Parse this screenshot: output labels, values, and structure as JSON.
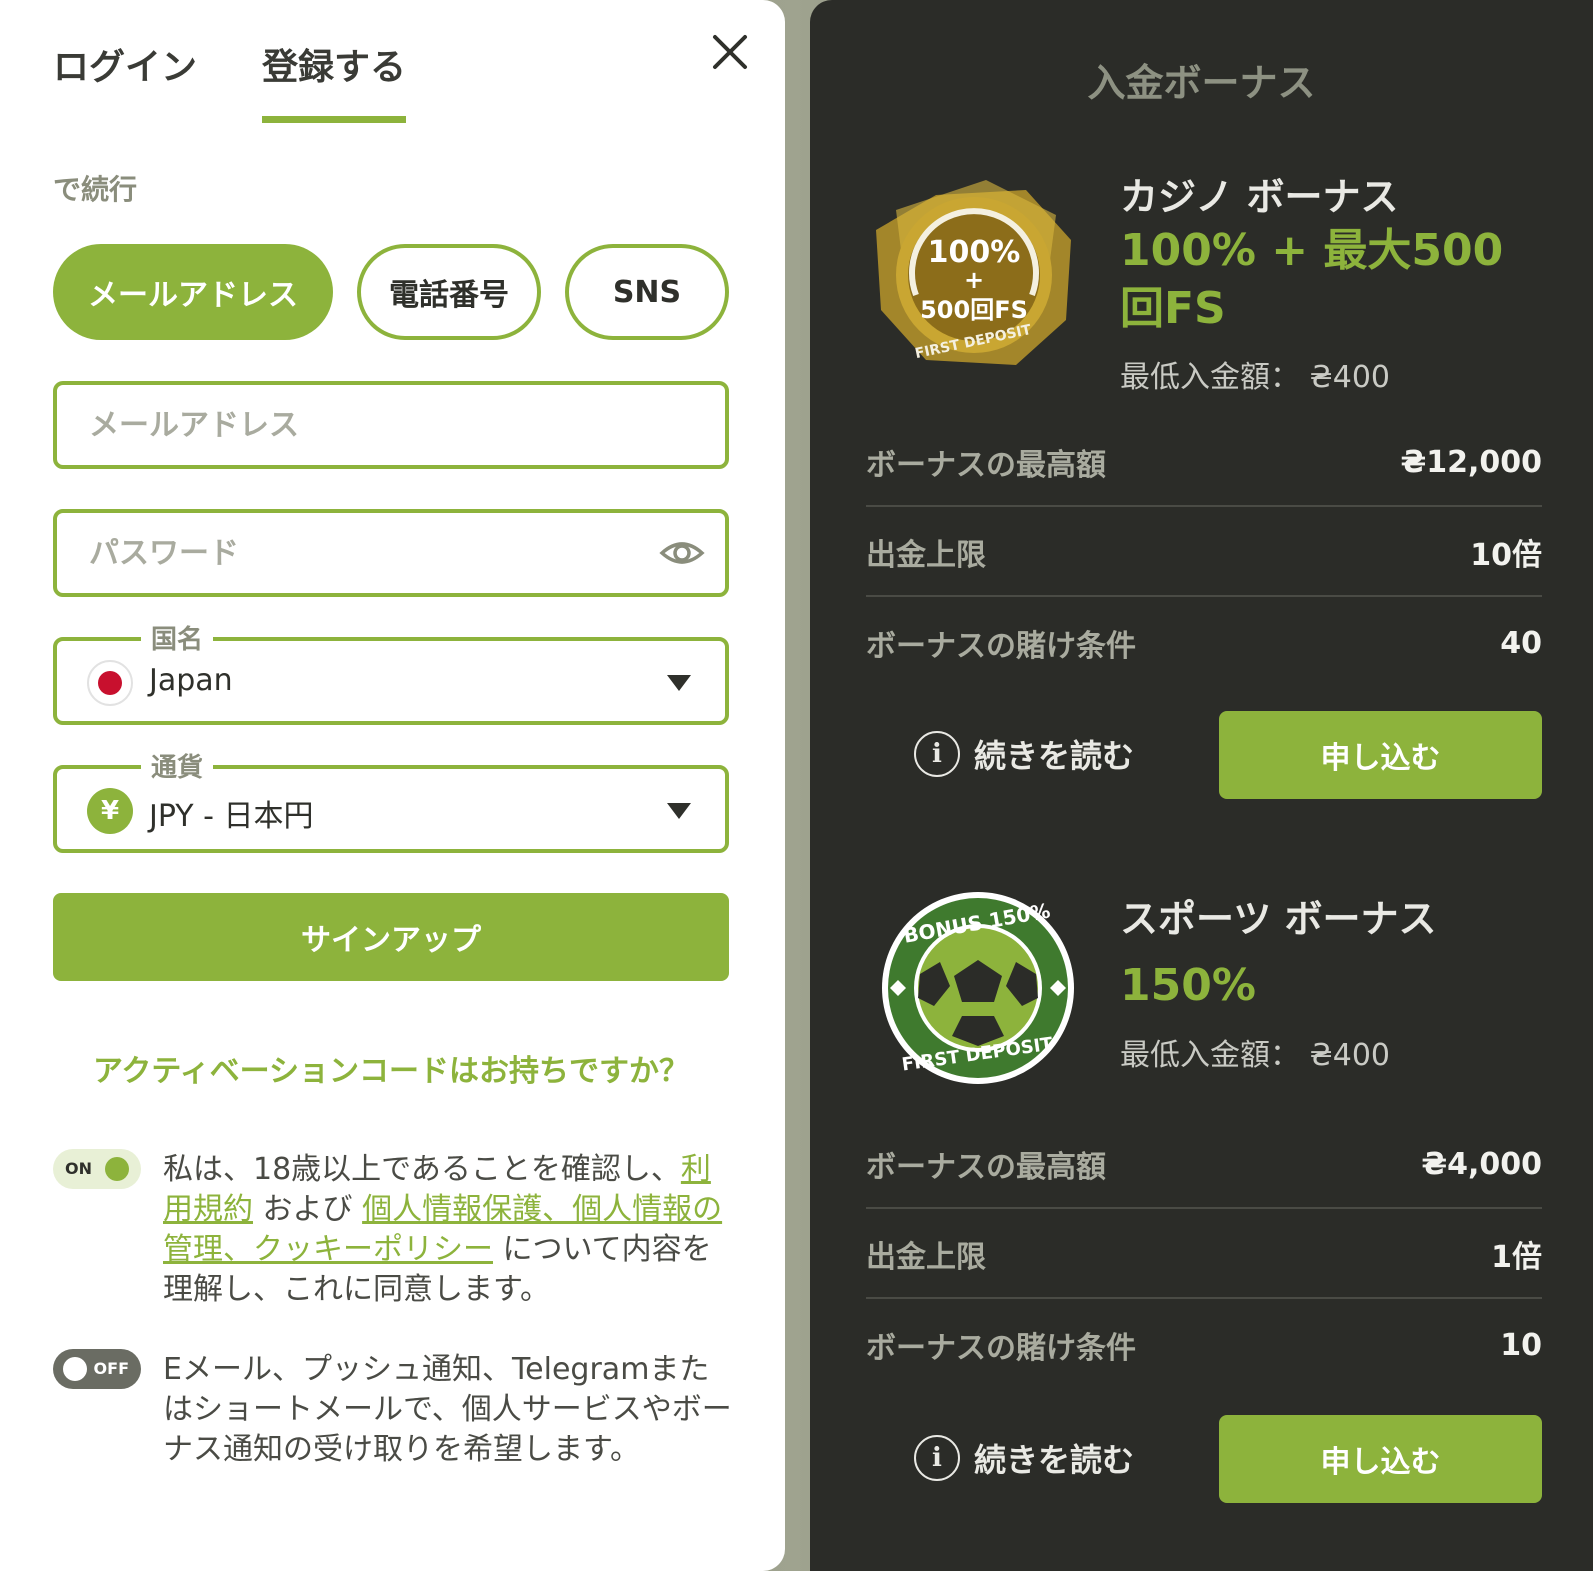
{
  "tabs": {
    "login": "ログイン",
    "register": "登録する"
  },
  "form": {
    "continue_with": "で続行",
    "methods": {
      "email": "メールアドレス",
      "phone": "電話番号",
      "sns": "SNS"
    },
    "email_placeholder": "メールアドレス",
    "password_placeholder": "パスワード",
    "country": {
      "label": "国名",
      "value": "Japan"
    },
    "currency": {
      "label": "通貨",
      "value": "JPY - 日本円",
      "symbol": "¥"
    },
    "signup_label": "サインアップ",
    "activation_link": "アクティベーションコードはお持ちですか？"
  },
  "consent": {
    "age": {
      "toggle": "ON",
      "text_before": "私は、18歳以上であることを確認し、",
      "terms_link": "利用規約",
      "text_mid": "および",
      "privacy_link": "個人情報保護、個人情報の管理、クッキーポリシー",
      "text_after": "について内容を理解し、これに同意します。"
    },
    "marketing": {
      "toggle": "OFF",
      "text": "Eメール、プッシュ通知、Telegramまたはショートメールで、個人サービスやボーナス通知の受け取りを希望します。"
    }
  },
  "bonus_panel": {
    "title": "入金ボーナス",
    "casino": {
      "badge_top": "100%",
      "badge_plus": "+",
      "badge_fs": "500回FS",
      "badge_ring": "FIRST DEPOSIT",
      "name": "カジノ ボーナス",
      "amount": "100% + 最大500回FS",
      "min_deposit": "最低入金額： ₴400",
      "rows": [
        {
          "key": "ボーナスの最高額",
          "value": "₴12,000"
        },
        {
          "key": "出金上限",
          "value": "10倍"
        },
        {
          "key": "ボーナスの賭け条件",
          "value": "40"
        }
      ],
      "read_more": "続きを読む",
      "apply": "申し込む"
    },
    "sports": {
      "badge_top": "BONUS 150%",
      "badge_bottom": "FIRST DEPOSIT",
      "name": "スポーツ ボーナス",
      "amount": "150%",
      "min_deposit": "最低入金額： ₴400",
      "rows": [
        {
          "key": "ボーナスの最高額",
          "value": "₴4,000"
        },
        {
          "key": "出金上限",
          "value": "1倍"
        },
        {
          "key": "ボーナスの賭け条件",
          "value": "10"
        }
      ],
      "read_more": "続きを読む",
      "apply": "申し込む"
    }
  },
  "colors": {
    "accent": "#8db33c",
    "dark_panel": "#2b2c28",
    "gold": "#c8a62c"
  }
}
